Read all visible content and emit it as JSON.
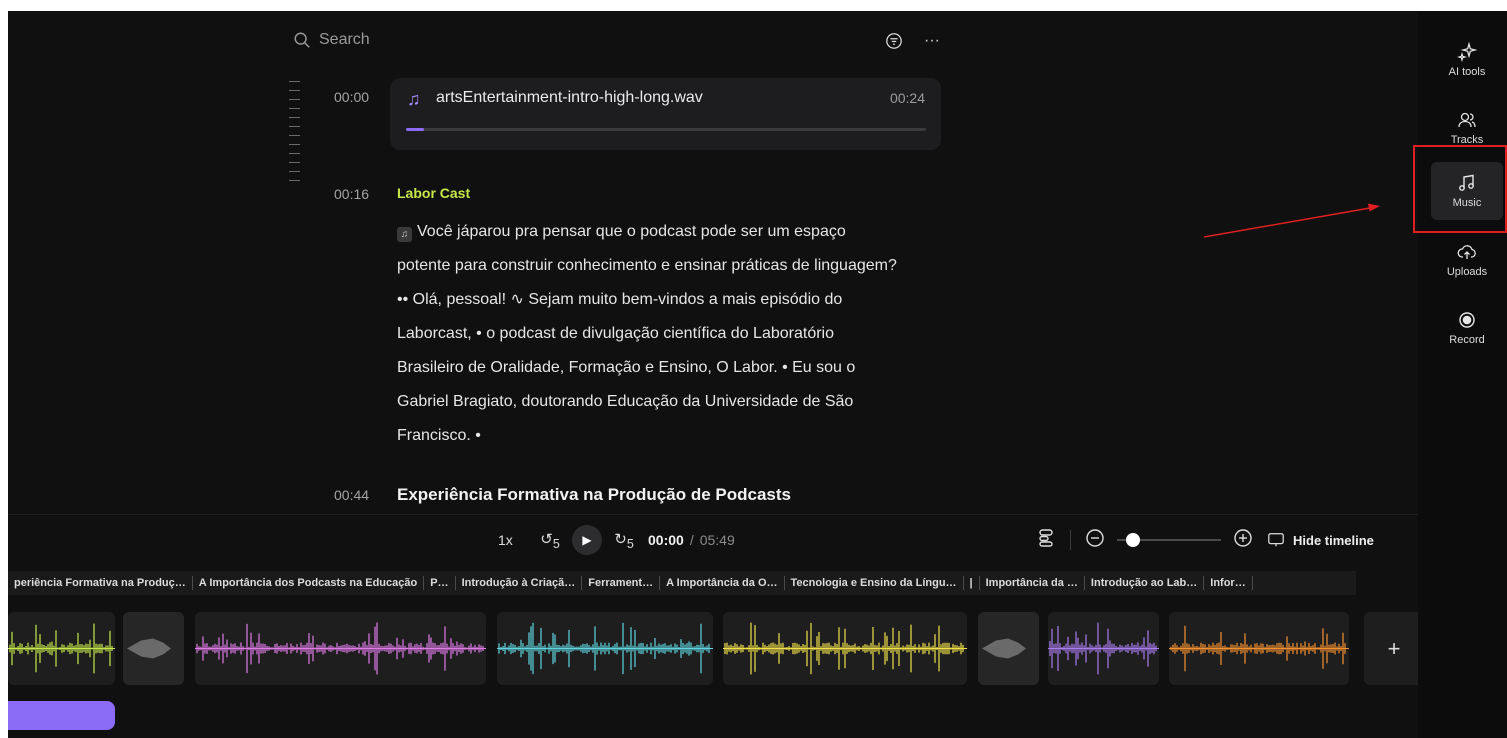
{
  "search": {
    "placeholder": "Search"
  },
  "top_icons": {
    "filter": "filter-icon",
    "more": "more-icon"
  },
  "music_item": {
    "timestamp": "00:00",
    "file_name": "artsEntertainment-intro-high-long.wav",
    "duration": "00:24",
    "progress_percent": 3.5
  },
  "transcript": {
    "timestamp": "00:16",
    "speaker": "Labor Cast",
    "tag_icon": "music-note-icon",
    "text": "Você jáparou pra pensar que o podcast pode ser um espaço potente para construir conhecimento e ensinar práticas de linguagem? •• Olá, pessoal! ∿ Sejam muito bem-vindos a mais episódio do Laborcast, • o podcast de divulgação científica do Laboratório Brasileiro de Oralidade, Formação e Ensino, O Labor. • Eu sou o Gabriel Bragiato, doutorando Educação da Universidade de São Francisco. •"
  },
  "next_section": {
    "timestamp": "00:44",
    "title": "Experiência Formativa na Produção de Podcasts"
  },
  "playback": {
    "speed": "1x",
    "skip_back": "5",
    "skip_forward": "5",
    "current_time": "00:00",
    "separator": "/",
    "total_time": "05:49",
    "zoom_level": 0.1,
    "hide_timeline": "Hide timeline"
  },
  "chapters": [
    "periência Formativa na Produç…",
    "A Importância dos Podcasts na Educação",
    "P…",
    "Introdução à Criaçã…",
    "Ferrament…",
    "A Importância da O…",
    "Tecnologia e Ensino da Língu…",
    "|",
    "Importância da …",
    "Introdução ao Lab…",
    "Infor…"
  ],
  "clip_colors": [
    "#c5e84a",
    "#e07be8",
    "#5fd6df",
    "#f0e04a",
    "#a97cf0",
    "#f5902e"
  ],
  "add_clip": "+",
  "sidebar": [
    {
      "label": "AI tools",
      "icon": "sparkles-icon"
    },
    {
      "label": "Tracks",
      "icon": "users-icon"
    },
    {
      "label": "Music",
      "icon": "music-note-icon"
    },
    {
      "label": "Uploads",
      "icon": "cloud-upload-icon"
    },
    {
      "label": "Record",
      "icon": "record-icon"
    }
  ],
  "colors": {
    "accent": "#8b6cf6",
    "speaker": "#c7e84a",
    "annotation": "#e02020"
  }
}
